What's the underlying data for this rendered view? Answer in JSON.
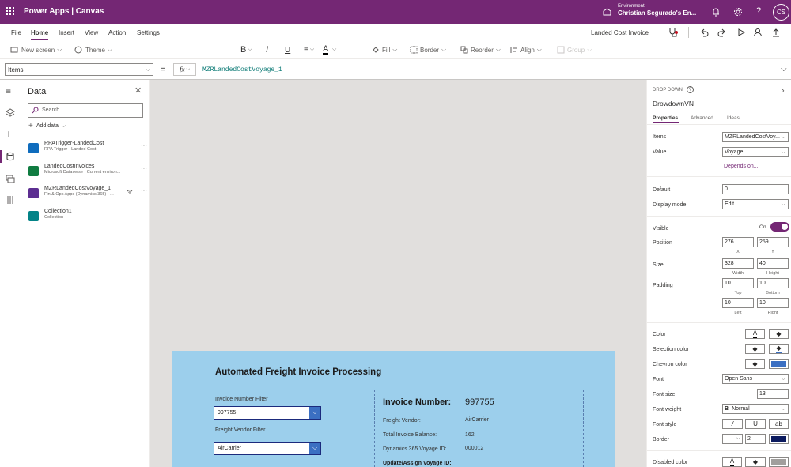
{
  "titlebar": {
    "app_name": "Power Apps  |  Canvas",
    "env_label": "Environment",
    "env_name": "Christian Segurado's En...",
    "avatar": "CS"
  },
  "menubar": {
    "items": [
      "File",
      "Home",
      "Insert",
      "View",
      "Action",
      "Settings"
    ],
    "active": "Home",
    "app_title": "Landed Cost Invoice"
  },
  "toolbar": {
    "new_screen": "New screen",
    "theme": "Theme",
    "font": "Open Sans",
    "font_size": "13",
    "fill": "Fill",
    "border": "Border",
    "reorder": "Reorder",
    "align": "Align",
    "group": "Group"
  },
  "formula": {
    "property": "Items",
    "fx": "fx",
    "value": "MZRLandedCostVoyage_1"
  },
  "data_panel": {
    "title": "Data",
    "search_placeholder": "Search",
    "add_data": "Add data",
    "sources": [
      {
        "name": "RPATrigger-LandedCost",
        "desc": "RPA Trigger - Landed Cost",
        "color": "#0f6cbd"
      },
      {
        "name": "LandedCostInvoices",
        "desc": "Microsoft Dataverse · Current environ...",
        "color": "#107c41"
      },
      {
        "name": "MZRLandedCostVoyage_1",
        "desc": "Fin & Ops Apps (Dynamics 365) · ...",
        "color": "#5c2e91"
      },
      {
        "name": "Collection1",
        "desc": "Collection",
        "color": "#038387"
      }
    ]
  },
  "screen": {
    "title": "Automated Freight Invoice Processing",
    "invoice_filter_label": "Invoice Number Filter",
    "invoice_filter_value": "997755",
    "vendor_filter_label": "Freight Vendor Filter",
    "vendor_filter_value": "AirCarrier",
    "card": {
      "invoice_label": "Invoice Number:",
      "invoice_value": "997755",
      "vendor_label": "Freight Vendor:",
      "vendor_value": "AirCarrier",
      "balance_label": "Total Invoice Balance:",
      "balance_value": "162",
      "voyage_label": "Dynamics 365 Voyage ID:",
      "voyage_value": "000012",
      "assign_label": "Update/Assign Voyage ID:"
    }
  },
  "properties": {
    "type": "DROP DOWN",
    "name": "DrowdownVN",
    "tabs": [
      "Properties",
      "Advanced",
      "Ideas"
    ],
    "items_label": "Items",
    "items_value": "MZRLandedCostVoy...",
    "value_label": "Value",
    "value_value": "Voyage",
    "depends_on": "Depends on...",
    "default_label": "Default",
    "default_value": "0",
    "display_mode_label": "Display mode",
    "display_mode_value": "Edit",
    "visible_label": "Visible",
    "visible_value": "On",
    "position_label": "Position",
    "pos_x": "276",
    "pos_y": "259",
    "x_label": "X",
    "y_label": "Y",
    "size_label": "Size",
    "width": "328",
    "height": "40",
    "width_label": "Width",
    "height_label": "Height",
    "padding_label": "Padding",
    "pad_top": "10",
    "pad_bottom": "10",
    "pad_left": "10",
    "pad_right": "10",
    "top_label": "Top",
    "bottom_label": "Bottom",
    "left_label": "Left",
    "right_label": "Right",
    "color_label": "Color",
    "selection_color_label": "Selection color",
    "chevron_color_label": "Chevron color",
    "chevron_color": "#3b6fc2",
    "font_label": "Font",
    "font_value": "Open Sans",
    "font_size_label": "Font size",
    "font_size_value": "13",
    "font_weight_label": "Font weight",
    "font_weight_value": "Normal",
    "font_style_label": "Font style",
    "border_label": "Border",
    "border_width": "2",
    "border_color": "#0b1a5e",
    "disabled_color_label": "Disabled color"
  }
}
